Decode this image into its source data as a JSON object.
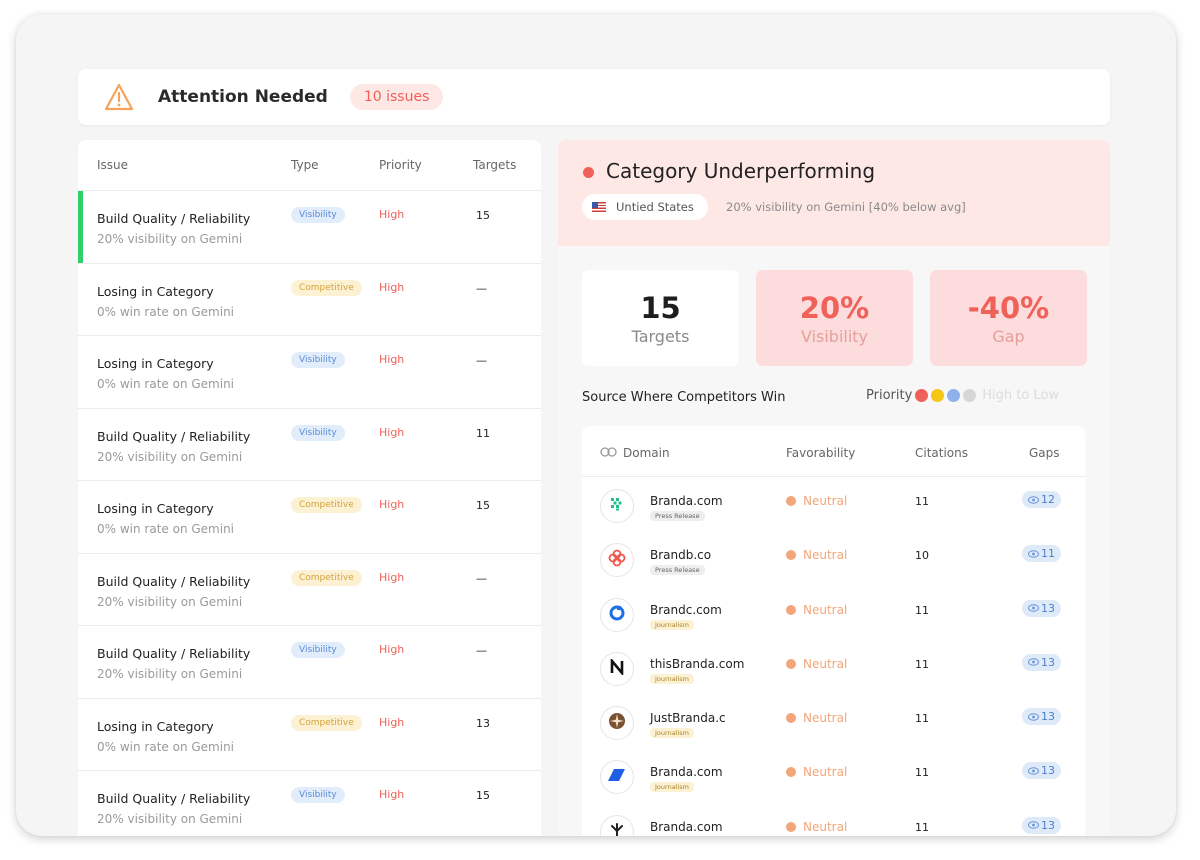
{
  "attention": {
    "title": "Attention Needed",
    "badge": "10 issues"
  },
  "issues_table": {
    "headers": {
      "issue": "Issue",
      "type": "Type",
      "priority": "Priority",
      "targets": "Targets"
    },
    "rows": [
      {
        "title": "Build Quality / Reliability",
        "subtitle": "20% visibility on Gemini",
        "type": "Visibility",
        "priority": "High",
        "targets": "15"
      },
      {
        "title": "Losing in Category",
        "subtitle": "0% win rate on Gemini",
        "type": "Competitive",
        "priority": "High",
        "targets": "—"
      },
      {
        "title": "Losing in Category",
        "subtitle": "0% win rate on Gemini",
        "type": "Visibility",
        "priority": "High",
        "targets": "—"
      },
      {
        "title": "Build Quality / Reliability",
        "subtitle": "20% visibility on Gemini",
        "type": "Visibility",
        "priority": "High",
        "targets": "11"
      },
      {
        "title": "Losing in Category",
        "subtitle": "0% win rate on Gemini",
        "type": "Competitive",
        "priority": "High",
        "targets": "15"
      },
      {
        "title": "Build Quality / Reliability",
        "subtitle": "20% visibility on Gemini",
        "type": "Competitive",
        "priority": "High",
        "targets": "—"
      },
      {
        "title": "Build Quality / Reliability",
        "subtitle": "20% visibility on Gemini",
        "type": "Visibility",
        "priority": "High",
        "targets": "—"
      },
      {
        "title": "Losing in Category",
        "subtitle": "0% win rate on Gemini",
        "type": "Competitive",
        "priority": "High",
        "targets": "13"
      },
      {
        "title": "Build Quality / Reliability",
        "subtitle": "20% visibility on Gemini",
        "type": "Visibility",
        "priority": "High",
        "targets": "15"
      }
    ]
  },
  "detail": {
    "title": "Category Underperforming",
    "country": "Untied States",
    "note": "20% visibility on Gemini [40% below avg]",
    "stats": [
      {
        "value": "15",
        "label": "Targets"
      },
      {
        "value": "20%",
        "label": "Visibility"
      },
      {
        "value": "-40%",
        "label": "Gap"
      }
    ],
    "sources_title": "Source Where Competitors Win",
    "priority_label": "Priority",
    "priority_hint": "High to Low",
    "priority_colors": [
      "#f0615a",
      "#f5c518",
      "#8fb2ea",
      "#d6d6d6"
    ],
    "domains_headers": {
      "domain": "Domain",
      "favorability": "Favorability",
      "citations": "Citations",
      "gaps": "Gaps"
    },
    "domains": [
      {
        "name": "Branda.com",
        "tag": "Press Release",
        "favorability": "Neutral",
        "citations": "11",
        "gaps": "12",
        "icon": "grid-diamond-icon"
      },
      {
        "name": "Brandb.co",
        "tag": "Press Release",
        "favorability": "Neutral",
        "citations": "10",
        "gaps": "11",
        "icon": "flower-icon"
      },
      {
        "name": "Brandc.com",
        "tag": "Journalism",
        "favorability": "Neutral",
        "citations": "11",
        "gaps": "13",
        "icon": "ring-icon"
      },
      {
        "name": "thisBranda.com",
        "tag": "Journalism",
        "favorability": "Neutral",
        "citations": "11",
        "gaps": "13",
        "icon": "n-letter-icon"
      },
      {
        "name": "JustBranda.c",
        "tag": "Journalism",
        "favorability": "Neutral",
        "citations": "11",
        "gaps": "13",
        "icon": "compass-icon"
      },
      {
        "name": "Branda.com",
        "tag": "Journalism",
        "favorability": "Neutral",
        "citations": "11",
        "gaps": "13",
        "icon": "parallelogram-icon"
      },
      {
        "name": "Branda.com",
        "tag": "",
        "favorability": "Neutral",
        "citations": "11",
        "gaps": "13",
        "icon": "leaf-icon"
      }
    ]
  }
}
